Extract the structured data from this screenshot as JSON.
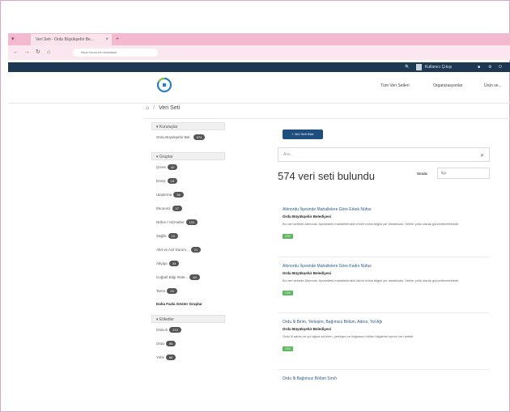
{
  "browser": {
    "tab_title": "Veri Seti - Ordu Büyükşehir Be...",
    "url": "https://ordu.bel.tr/dataset",
    "new_tab": "+",
    "tab_close": "×"
  },
  "topstrip": {
    "user": "Kullanıcı Çıkışı"
  },
  "header": {
    "links": [
      "Tüm Veri Setleri",
      "Organizasyonlar",
      "Ürün ve..."
    ]
  },
  "breadcrumb": {
    "home": "⌂",
    "current": "Veri Seti"
  },
  "sidebar": {
    "orgs_header": "Kuruluşlar",
    "orgs": [
      {
        "label": "Ordu Büyükşehir Bel.",
        "count": "574"
      }
    ],
    "groups_header": "Gruplar",
    "groups": [
      {
        "label": "Çevre",
        "count": "42"
      },
      {
        "label": "Enerji",
        "count": "18"
      },
      {
        "label": "Ulaştırma",
        "count": "36"
      },
      {
        "label": "Ekonomi",
        "count": "27"
      },
      {
        "label": "Nüfus / Hizmetler",
        "count": "124"
      },
      {
        "label": "Sağlık",
        "count": "15"
      },
      {
        "label": "Afet ve Acil Durum...",
        "count": "21"
      },
      {
        "label": "Altyapı",
        "count": "33"
      },
      {
        "label": "Coğrafi Bilgi Siste...",
        "count": "48"
      },
      {
        "label": "Tarım",
        "count": "29"
      }
    ],
    "show_all": "Daha Fazla Göster Gruplar",
    "tags_header": "Etiketler",
    "tags": [
      {
        "label": "Ordu ili",
        "count": "210"
      },
      {
        "label": "Ordu",
        "count": "96"
      },
      {
        "label": "Yıllık",
        "count": "88"
      }
    ]
  },
  "main": {
    "new_button": "+ Veri Seti Ekle",
    "search_placeholder": "Ara...",
    "result_count": "574 veri seti bulundu",
    "order_label": "Sırala:",
    "order_value": "İlgi",
    "datasets": [
      {
        "title": "Altınordu İlçesinde Mahallelere Göre Erkek Nüfus",
        "org": "Ordu Büyükşehir Belediyesi",
        "desc": "Bu veri setinde Altınordu İlçesindeki mahallelerdeki erkek nüfus bilgisi yer almaktadır. Veriler yıllık olarak güncellenmektedir.",
        "tag": "CSV"
      },
      {
        "title": "Altınordu İlçesinde Mahallelere Göre Kadın Nüfus",
        "org": "Ordu Büyükşehir Belediyesi",
        "desc": "Bu veri setinde Altınordu İlçesindeki mahallelerdeki kadın nüfus bilgisi yer almaktadır. Veriler yıllık olarak güncellenmektedir.",
        "tag": "CSV"
      },
      {
        "title": "Ordu İli Birim, Yerleşim, Bağımsız Bölüm, Adres, Yol Ağı",
        "org": "Ordu Büyükşehir Belediyesi",
        "desc": "Ordu ili adres ve yol ağına ait birim, yerleşim ve bağımsız bölüm bilgilerini içeren veri setidir.",
        "tag": "CSV"
      },
      {
        "title": "Ordu İli Bağımsız Bölüm Sınıfı",
        "org": "",
        "desc": "",
        "tag": ""
      }
    ]
  }
}
